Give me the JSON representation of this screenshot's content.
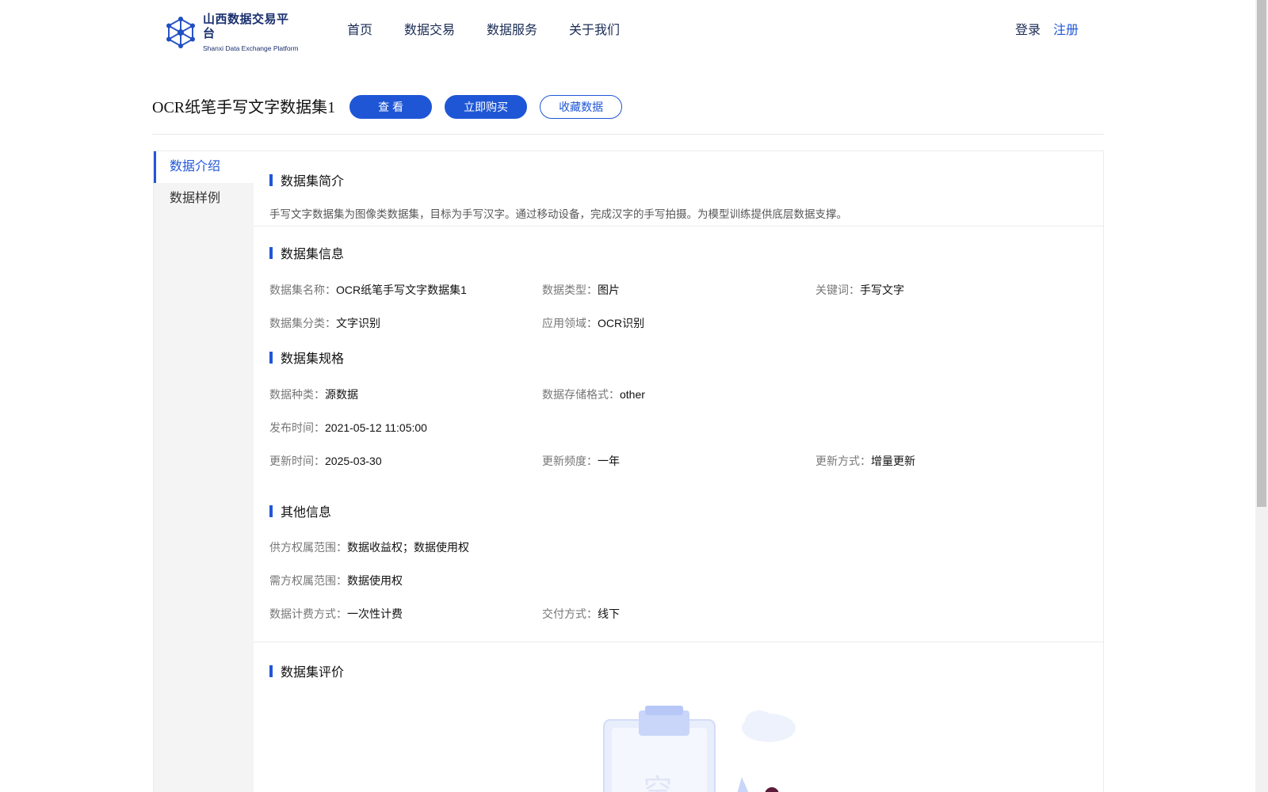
{
  "brand": {
    "name_cn": "山西数据交易平台",
    "name_en": "Shanxi Data Exchange Platform",
    "color": "#1a2f6e"
  },
  "nav": {
    "items": [
      "首页",
      "数据交易",
      "数据服务",
      "关于我们"
    ]
  },
  "auth": {
    "login": "登录",
    "register": "注册"
  },
  "dataset": {
    "title": "OCR纸笔手写文字数据集1",
    "buttons": {
      "view": "查 看",
      "buy": "立即购买",
      "favorite": "收藏数据"
    }
  },
  "sidebar": {
    "items": [
      "数据介绍",
      "数据样例"
    ],
    "active": 0
  },
  "sections": {
    "intro": {
      "heading": "数据集简介",
      "text": "手写文字数据集为图像类数据集，目标为手写汉字。通过移动设备，完成汉字的手写拍摄。为模型训练提供底层数据支撑。"
    },
    "info": {
      "heading": "数据集信息",
      "fields": [
        {
          "key": "数据集名称：",
          "value": "OCR纸笔手写文字数据集1"
        },
        {
          "key": "数据类型：",
          "value": "图片"
        },
        {
          "key": "关键词：",
          "value": "手写文字"
        },
        {
          "key": "数据集分类：",
          "value": "文字识别"
        },
        {
          "key": "应用领域：",
          "value": "OCR识别"
        }
      ]
    },
    "spec": {
      "heading": "数据集规格",
      "fields": [
        {
          "key": "数据种类：",
          "value": "源数据"
        },
        {
          "key": "数据存储格式：",
          "value": "other"
        },
        {
          "key": "发布时间：",
          "value": "2021-05-12 11:05:00"
        },
        {
          "key": "更新时间：",
          "value": "2025-03-30"
        },
        {
          "key": "更新频度：",
          "value": "一年"
        },
        {
          "key": "更新方式：",
          "value": "增量更新"
        }
      ]
    },
    "other": {
      "heading": "其他信息",
      "fields": [
        {
          "key": "供方权属范围：",
          "value": "数据收益权；数据使用权"
        },
        {
          "key": "需方权属范围：",
          "value": "数据使用权"
        },
        {
          "key": "数据计费方式：",
          "value": "一次性计费"
        },
        {
          "key": "交付方式：",
          "value": "线下"
        }
      ]
    },
    "review": {
      "heading": "数据集评价",
      "empty_glyph": "空"
    }
  },
  "colors": {
    "accent": "#1f56d6",
    "sidebar_bg": "#f4f4f4"
  }
}
